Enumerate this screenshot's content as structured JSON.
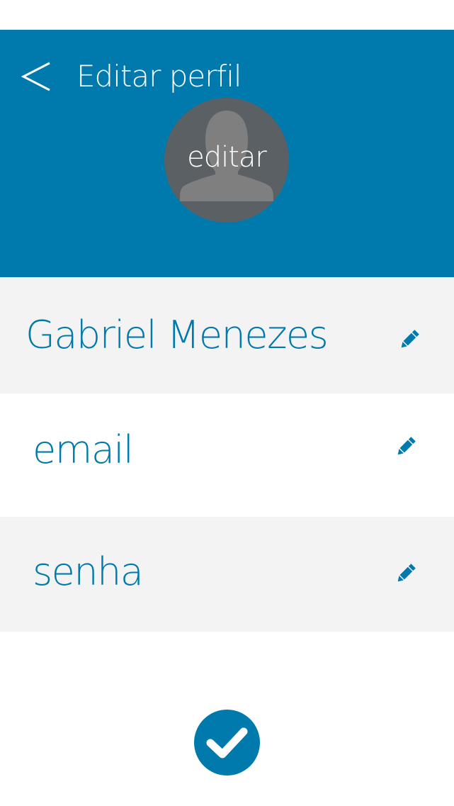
{
  "header": {
    "title": "Editar perfil",
    "back_icon": "chevron-left-icon",
    "background_color": "#007aac"
  },
  "avatar": {
    "label": "editar",
    "icon": "user-silhouette-icon",
    "background_color": "#5b6064"
  },
  "fields": [
    {
      "value": "Gabriel Menezes",
      "icon": "pencil-icon"
    },
    {
      "value": "email",
      "icon": "pencil-icon"
    },
    {
      "value": "senha",
      "icon": "pencil-icon"
    }
  ],
  "confirm": {
    "icon": "checkmark-icon"
  },
  "colors": {
    "accent": "#007aac",
    "row_alt": "#f3f3f3"
  }
}
